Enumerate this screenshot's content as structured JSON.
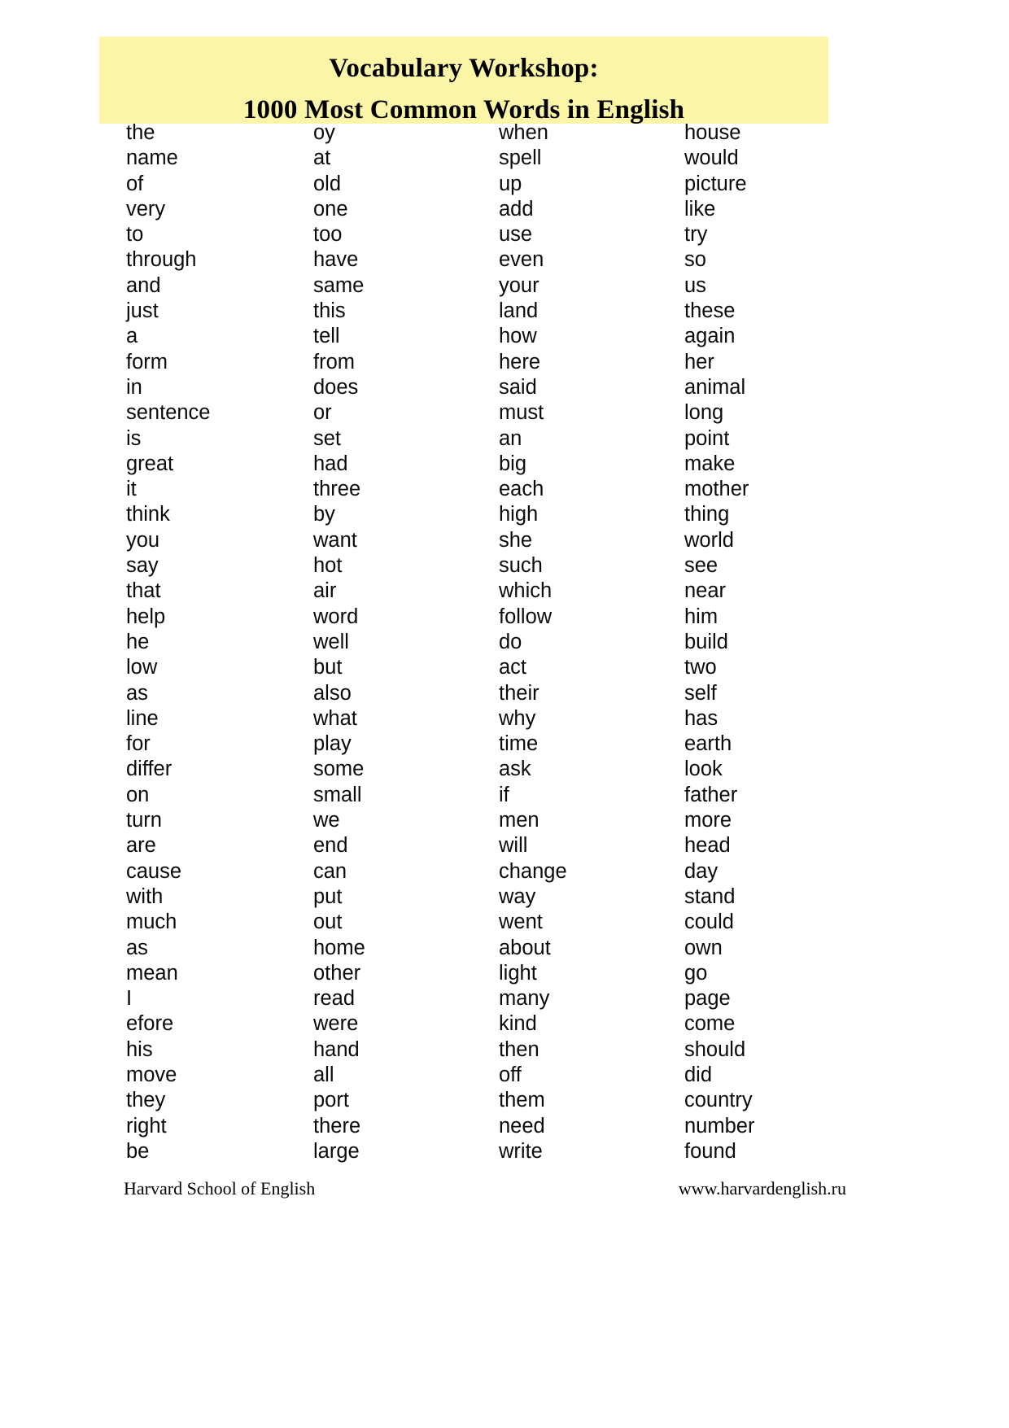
{
  "document": {
    "title_line_1": "Vocabulary Workshop:",
    "title_line_2": "1000 Most Common Words in English",
    "highlight_color": "#fbf5a8",
    "text_color": "#000000",
    "background_color": "#ffffff"
  },
  "word_columns": [
    {
      "index": 1,
      "words": [
        "the",
        "name",
        "of",
        "very",
        "to",
        "through",
        "and",
        "just",
        "a",
        "form",
        "in",
        "sentence",
        "is",
        "great",
        "it",
        "think",
        "you",
        "say",
        "that",
        "help",
        "he",
        "low",
        "as",
        "line",
        "for",
        "differ",
        "on",
        "turn",
        "are",
        "cause",
        "with",
        "much",
        "as",
        "mean",
        "I",
        "efore",
        "his",
        "move",
        "they",
        "right",
        "be"
      ]
    },
    {
      "index": 2,
      "words": [
        "oy",
        "at",
        "old",
        "one",
        "too",
        "have",
        "same",
        "this",
        "tell",
        "from",
        "does",
        "or",
        "set",
        "had",
        "three",
        "by",
        "want",
        "hot",
        "air",
        "word",
        "well",
        "but",
        "also",
        "what",
        "play",
        "some",
        "small",
        "we",
        "end",
        "can",
        "put",
        "out",
        "home",
        "other",
        "read",
        "were",
        "hand",
        "all",
        "port",
        "there",
        "large"
      ]
    },
    {
      "index": 3,
      "words": [
        "when",
        "spell",
        "up",
        "add",
        "use",
        "even",
        "your",
        "land",
        "how",
        "here",
        "said",
        "must",
        "an",
        "big",
        "each",
        "high",
        "she",
        "such",
        "which",
        "follow",
        "do",
        "act",
        "their",
        "why",
        "time",
        "ask",
        "if",
        "men",
        "will",
        "change",
        "way",
        "went",
        "about",
        "light",
        "many",
        "kind",
        "then",
        "off",
        "them",
        "need",
        "write"
      ]
    },
    {
      "index": 4,
      "words": [
        "house",
        "would",
        "picture",
        "like",
        "try",
        "so",
        "us",
        "these",
        "again",
        "her",
        "animal",
        "long",
        "point",
        "make",
        "mother",
        "thing",
        "world",
        "see",
        "near",
        "him",
        "build",
        "two",
        "self",
        "has",
        "earth",
        "look",
        "father",
        "more",
        "head",
        "day",
        "stand",
        "could",
        "own",
        "go",
        "page",
        "come",
        "should",
        "did",
        "country",
        "number",
        "found"
      ]
    }
  ],
  "footer": {
    "organization": "Harvard School of English",
    "website": "www.harvardenglish.ru"
  }
}
